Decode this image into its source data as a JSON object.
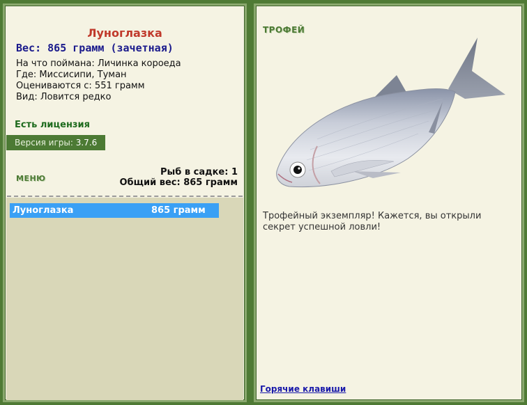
{
  "fish": {
    "name": "Луноглазка",
    "weight_line": "Вес: 865 грамм (зачетная)",
    "bait_line": "На что поймана: Личинка короеда",
    "location_line": "Где: Миссисипи, Туман",
    "value_line": "Оцениваются с: 551 грамм",
    "kind_line": "Вид: Ловится редко"
  },
  "license": "Есть лицензия",
  "version": {
    "label": "Версия игры:",
    "value": "3.7.6"
  },
  "menu_label": "МЕНЮ",
  "cage": {
    "count_line": "Рыб в садке: 1",
    "total_line": "Общий вес: 865 грамм"
  },
  "list": [
    {
      "name": "Луноглазка",
      "weight": "865 грамм"
    }
  ],
  "trophy": {
    "heading": "ТРОФЕЙ",
    "description": "Трофейный экземпляр! Кажется, вы открыли секрет успешной ловли!"
  },
  "hotkeys_label": "Горячие клавиши",
  "colors": {
    "frame": "#4f7a35",
    "panel": "#f5f3e3",
    "list_bg": "#d9d7b8",
    "highlight": "#3aa0f5",
    "fish_name": "#c0392b"
  }
}
